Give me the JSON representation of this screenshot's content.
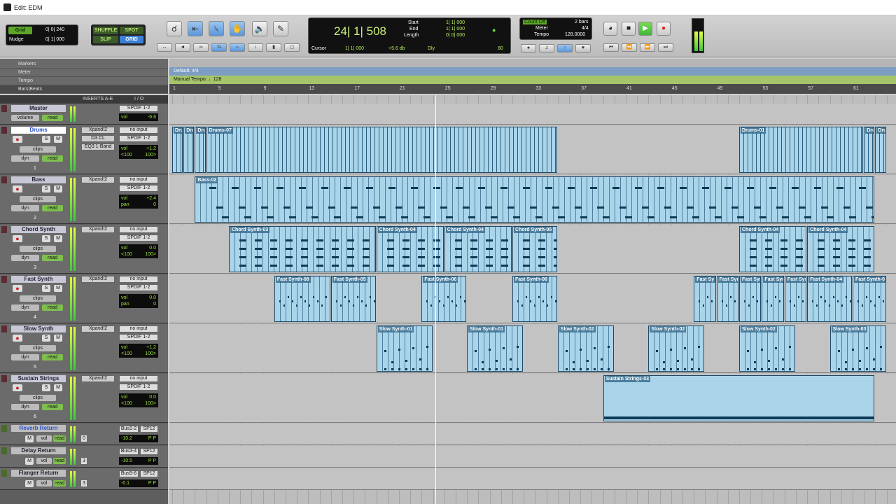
{
  "window": {
    "title": "Edit: EDM"
  },
  "toolbar": {
    "grid_label": "Grid",
    "grid_value": "0| 0| 240",
    "nudge_label": "Nudge",
    "nudge_value": "0| 1| 000",
    "modes": {
      "shuffle": "SHUFFLE",
      "spot": "SPOT",
      "slip": "SLIP",
      "grid": "GRID"
    }
  },
  "counter": {
    "main": "24| 1| 508",
    "start_label": "Start",
    "start_value": "1| 1| 000",
    "end_label": "End",
    "end_value": "1| 1| 000",
    "length_label": "Length",
    "length_value": "0| 0| 000",
    "cursor_label": "Cursor",
    "cursor_value": "1| 1| 000",
    "cursor_db": "+5.6 db",
    "dly": "Dly",
    "nudge_num": "80"
  },
  "metronome": {
    "count_off": "Count Off",
    "bars": "2 bars",
    "meter_label": "Meter",
    "meter_value": "4/4",
    "tempo_label": "Tempo",
    "tempo_value": "128.0000"
  },
  "rulers": {
    "markers": "Markers",
    "meter": "Meter",
    "tempo": "Tempo",
    "bars_beats": "Bars|Beats",
    "meter_text": "Default: 4/4",
    "tempo_text": "Manual Tempo:",
    "tempo_num": "128",
    "bar_numbers": [
      "1",
      "5",
      "9",
      "13",
      "17",
      "21",
      "25",
      "29",
      "33",
      "37",
      "41",
      "45",
      "49",
      "53",
      "57",
      "61"
    ]
  },
  "columns": {
    "inserts": "INSERTS A-E",
    "io": "I / O"
  },
  "tracks": [
    {
      "name": "Master",
      "color": "#5a2a35",
      "mode1": "volume",
      "mode1b": "read",
      "io_out": "SPDIF 1-2",
      "vol_label": "vol",
      "vol": "-6.6"
    },
    {
      "name": "Drums",
      "color": "#5a2a35",
      "insert1": "Xpand!2",
      "insert2": "D3 CL",
      "insert3": "EQ3 1-Band",
      "io_in": "no input",
      "io_out": "SPDIF 1-2",
      "vol_label": "vol",
      "vol": "+1.2",
      "pan_l": "<100",
      "pan_r": "100>",
      "clips_label": "clips",
      "dyn_label": "dyn",
      "dyn_read": "read",
      "num": "1"
    },
    {
      "name": "Bass",
      "color": "#5a2a35",
      "insert1": "Xpand!2",
      "io_in": "no input",
      "io_out": "SPDIF 1-2",
      "vol_label": "vol",
      "vol": "+2.4",
      "pan_label": "pan",
      "pan": "0",
      "clips_label": "clips",
      "dyn_label": "dyn",
      "dyn_read": "read",
      "num": "2"
    },
    {
      "name": "Chord Synth",
      "color": "#5a2a35",
      "insert1": "Xpand!2",
      "io_in": "no input",
      "io_out": "SPDIF 1-2",
      "vol_label": "vol",
      "vol": "0.0",
      "pan_l": "<100",
      "pan_r": "100>",
      "clips_label": "clips",
      "dyn_label": "dyn",
      "dyn_read": "read",
      "num": "3"
    },
    {
      "name": "Fast Synth",
      "color": "#5a2a35",
      "insert1": "Xpand!2",
      "io_in": "no input",
      "io_out": "SPDIF 1-2",
      "vol_label": "vol",
      "vol": "0.0",
      "pan_label": "pan",
      "pan": "0",
      "clips_label": "clips",
      "dyn_label": "dyn",
      "dyn_read": "read",
      "num": "4"
    },
    {
      "name": "Slow Synth",
      "color": "#5a2a35",
      "insert1": "Xpand!2",
      "io_in": "no input",
      "io_out": "SPDIF 1-2",
      "vol_label": "vol",
      "vol": "+1.2",
      "pan_l": "<100",
      "pan_r": "100>",
      "clips_label": "clips",
      "dyn_label": "dyn",
      "dyn_read": "read",
      "num": "5"
    },
    {
      "name": "Sustain Strings",
      "color": "#5a2a35",
      "insert1": "Xpand!2",
      "io_in": "no input",
      "io_out": "SPDIF 1-2",
      "vol_label": "vol",
      "vol": "0.0",
      "pan_l": "<100",
      "pan_r": "100>",
      "clips_label": "clips",
      "dyn_label": "dyn",
      "dyn_read": "read",
      "num": "6"
    }
  ],
  "aux_tracks": [
    {
      "name": "Reverb Return",
      "mode": "vol",
      "read": "read",
      "io_in": "Bus1-2",
      "io_out": "SP12",
      "vol": "-10.2",
      "p1": "P",
      "p2": "P",
      "num": "0"
    },
    {
      "name": "Delay Return",
      "mode": "vol",
      "read": "read",
      "io_in": "Bus3-4",
      "io_out": "SP12",
      "vol": "-10.5",
      "p1": "P",
      "p2": "P",
      "num": "3"
    },
    {
      "name": "Flanger Return",
      "mode": "vol",
      "read": "read",
      "io_in": "Bus5-6",
      "io_out": "SP12",
      "vol": "-0.1",
      "p1": "P",
      "p2": "P",
      "num": "3"
    }
  ],
  "clips": {
    "drums": [
      {
        "name": "Dru",
        "start": 0,
        "len": 1
      },
      {
        "name": "Dru",
        "start": 1,
        "len": 1
      },
      {
        "name": "Dru",
        "start": 2,
        "len": 1
      },
      {
        "name": "Drums-07",
        "start": 3,
        "len": 31
      },
      {
        "name": "Drums-01",
        "start": 50,
        "len": 11
      },
      {
        "name": "Dru",
        "start": 61,
        "len": 1
      },
      {
        "name": "Dru",
        "start": 62,
        "len": 1
      }
    ],
    "bass": [
      {
        "name": "Bass-02",
        "start": 2,
        "len": 60
      }
    ],
    "chord": [
      {
        "name": "Chord Synth-03",
        "start": 5,
        "len": 13
      },
      {
        "name": "Chord Synth-04",
        "start": 18,
        "len": 6
      },
      {
        "name": "Chord Synth-04",
        "start": 24,
        "len": 6
      },
      {
        "name": "Chord Synth-05",
        "start": 30,
        "len": 4
      },
      {
        "name": "Chord Synth-04",
        "start": 50,
        "len": 6
      },
      {
        "name": "Chord Synth-04",
        "start": 56,
        "len": 6
      }
    ],
    "fast": [
      {
        "name": "Fast Synth-08",
        "start": 9,
        "len": 5
      },
      {
        "name": "Fast Synth-05",
        "start": 14,
        "len": 4
      },
      {
        "name": "Fast Synth-06",
        "start": 22,
        "len": 4
      },
      {
        "name": "Fast Synth-06",
        "start": 30,
        "len": 4
      },
      {
        "name": "Fast Sy",
        "start": 46,
        "len": 2
      },
      {
        "name": "Fast Syn",
        "start": 48,
        "len": 2
      },
      {
        "name": "Fast Syn",
        "start": 50,
        "len": 2
      },
      {
        "name": "Fast Syn",
        "start": 52,
        "len": 2
      },
      {
        "name": "Fast Syn",
        "start": 54,
        "len": 2
      },
      {
        "name": "Fast Synth-04",
        "start": 56,
        "len": 4
      },
      {
        "name": "Fast Synth-0",
        "start": 60,
        "len": 3
      }
    ],
    "slow": [
      {
        "name": "Slow Synth-01",
        "start": 18,
        "len": 5
      },
      {
        "name": "Slow Synth-01",
        "start": 26,
        "len": 5
      },
      {
        "name": "Slow Synth-02",
        "start": 34,
        "len": 5
      },
      {
        "name": "Slow Synth-02",
        "start": 42,
        "len": 5
      },
      {
        "name": "Slow Synth-02",
        "start": 50,
        "len": 5
      },
      {
        "name": "Slow Synth-03",
        "start": 58,
        "len": 5
      }
    ],
    "strings": [
      {
        "name": "Sustain Strings-03",
        "start": 38,
        "len": 24
      }
    ]
  },
  "colors": {
    "clip_fill": "#a9d4ea",
    "clip_dark": "#1e4a68",
    "meter_ruler": "#7d9dc2",
    "tempo_ruler": "#a6c56b",
    "play_green": "#3cb838"
  }
}
